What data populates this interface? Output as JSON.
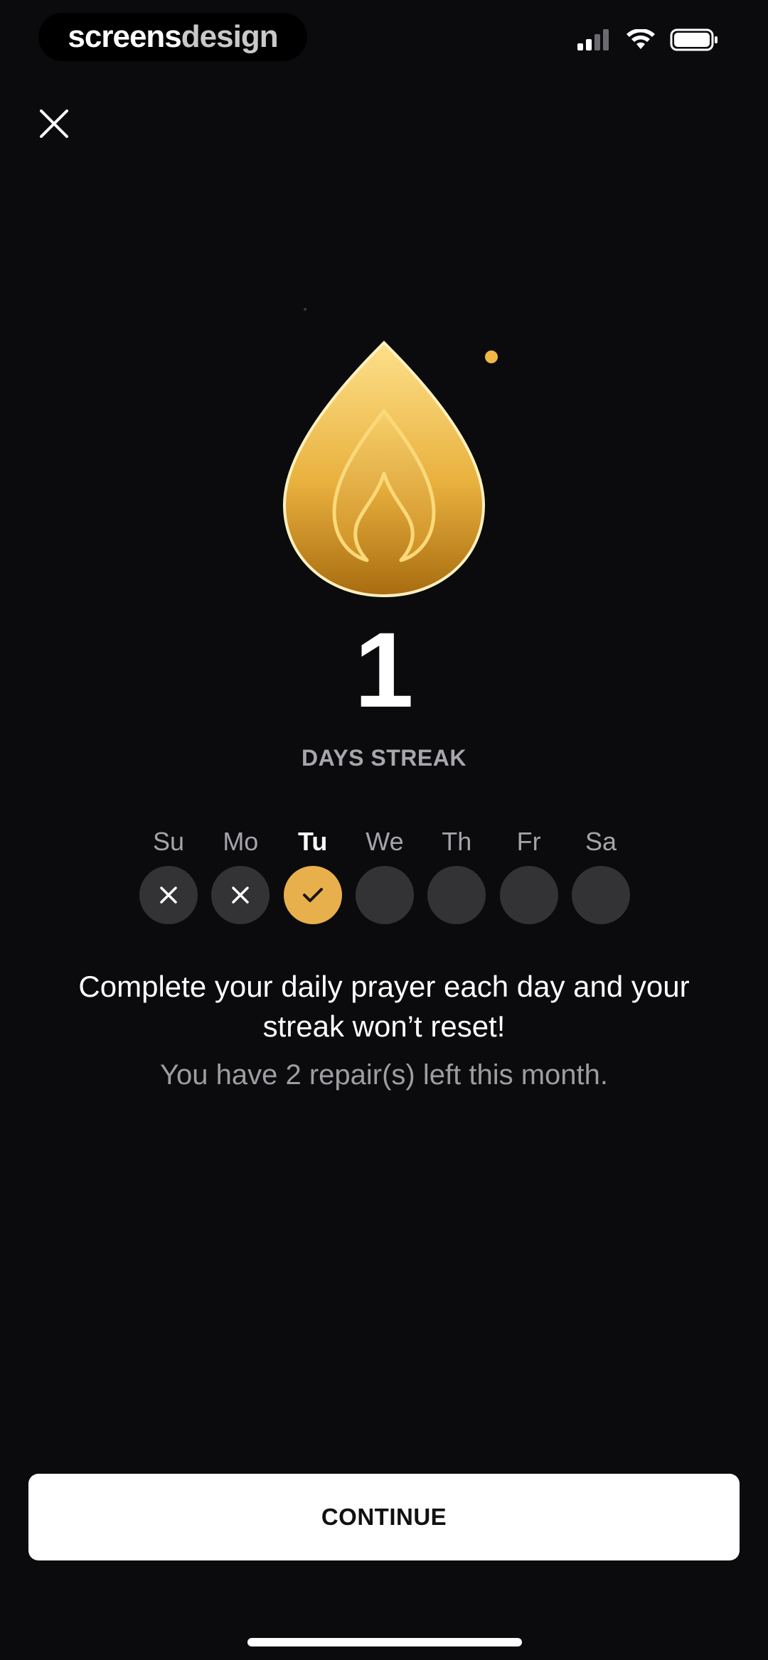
{
  "watermark": {
    "part1": "screens",
    "part2": "design"
  },
  "status_bar": {
    "icons": [
      "signal-icon",
      "wifi-icon",
      "battery-icon"
    ]
  },
  "streak": {
    "count": "1",
    "label": "DAYS STREAK",
    "icon": "flame-icon",
    "accent_color": "#e8b04c"
  },
  "week": {
    "days": [
      {
        "name": "Su",
        "status": "missed"
      },
      {
        "name": "Mo",
        "status": "missed"
      },
      {
        "name": "Tu",
        "status": "done"
      },
      {
        "name": "We",
        "status": "pending"
      },
      {
        "name": "Th",
        "status": "pending"
      },
      {
        "name": "Fr",
        "status": "pending"
      },
      {
        "name": "Sa",
        "status": "pending"
      }
    ]
  },
  "message": {
    "main": "Complete your daily prayer each day and your streak won’t reset!",
    "repairs": "You have 2 repair(s) left this month."
  },
  "continue_label": "CONTINUE"
}
